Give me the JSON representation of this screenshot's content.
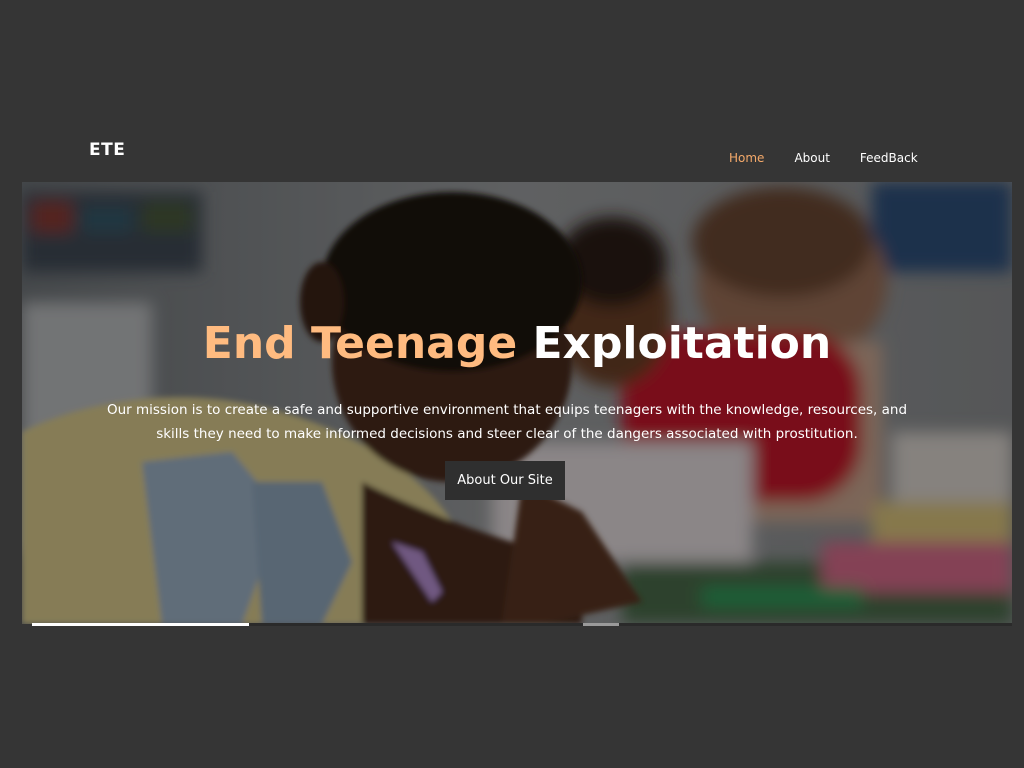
{
  "brand": {
    "logo": "ETE"
  },
  "nav": {
    "items": [
      {
        "label": "Home",
        "active": true
      },
      {
        "label": "About",
        "active": false
      },
      {
        "label": "FeedBack",
        "active": false
      }
    ]
  },
  "hero": {
    "title_accent": "End Teenage",
    "title_rest": "Exploitation",
    "description": "Our mission is to create a safe and supportive environment that equips teenagers with the knowledge, resources, and skills they need to make informed decisions and steer clear of the dangers associated with prostitution.",
    "button_label": "About Our Site"
  },
  "slider": {
    "slide_count": 3,
    "active_index": 0
  },
  "colors": {
    "background": "#353535",
    "accent": "#f4a96a",
    "title_accent": "#ffbb80",
    "button_bg": "#2f2f2f"
  }
}
